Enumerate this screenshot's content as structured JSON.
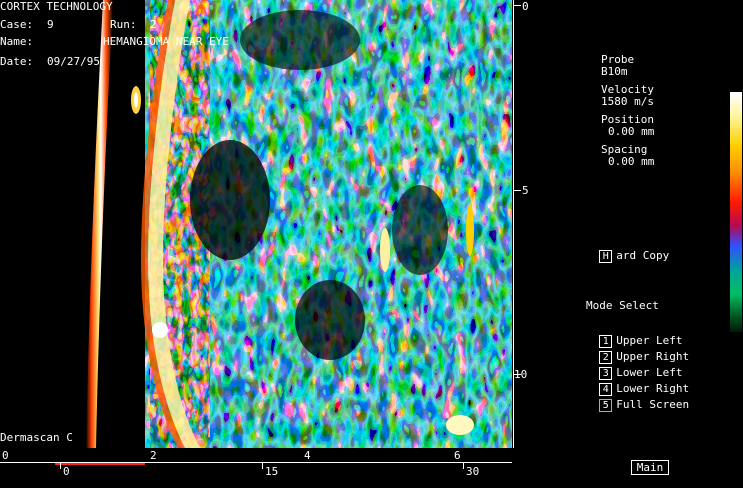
{
  "header": {
    "company": "CORTEX TECHNOLOGY",
    "case_label": "Case:",
    "case_value": "9",
    "run_label": "Run:",
    "run_value": "2",
    "name_label": "Name:",
    "name_value": "HEMANGIOMA NEAR EYE",
    "date_label": "Date:",
    "date_value": "09/27/95",
    "device": "Dermascan C"
  },
  "depth_axis": {
    "labels": [
      "0",
      "5",
      "10"
    ]
  },
  "bottom_axis": {
    "upper_labels": [
      "0",
      "2",
      "4",
      "6"
    ],
    "lower_labels": [
      "0",
      "15",
      "30"
    ]
  },
  "panel": {
    "probe_label": "Probe",
    "probe_value": "B10m",
    "velocity_label": "Velocity",
    "velocity_value": "1580 m/s",
    "position_label": "Position",
    "position_value": "0.00 mm",
    "spacing_label": "Spacing",
    "spacing_value": "0.00 mm",
    "hardcopy_key": "H",
    "hardcopy_label": "ard Copy",
    "mode_title": "Mode Select",
    "modes": [
      {
        "key": "1",
        "label": "Upper Left"
      },
      {
        "key": "2",
        "label": "Upper Right"
      },
      {
        "key": "3",
        "label": "Lower Left"
      },
      {
        "key": "4",
        "label": "Lower Right"
      },
      {
        "key": "5",
        "label": "Full Screen"
      }
    ],
    "main_button": "Main"
  },
  "colors": {
    "active_mode_border": "#33ff33",
    "marker_red": "#ff2020"
  }
}
